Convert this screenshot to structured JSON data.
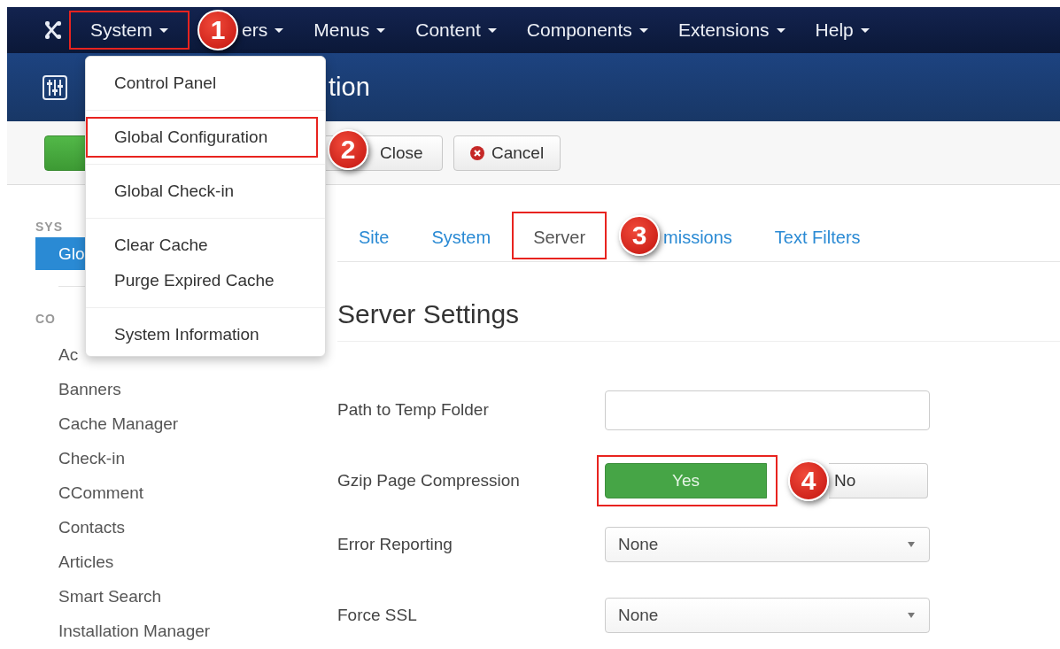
{
  "navbar": {
    "items": [
      {
        "label": "System",
        "highlighted": true,
        "badge": "1"
      },
      {
        "label": "ers",
        "highlighted": false
      },
      {
        "label": "Menus",
        "highlighted": false
      },
      {
        "label": "Content",
        "highlighted": false
      },
      {
        "label": "Components",
        "highlighted": false
      },
      {
        "label": "Extensions",
        "highlighted": false
      },
      {
        "label": "Help",
        "highlighted": false
      }
    ]
  },
  "dropdown": {
    "groups": [
      {
        "items": [
          {
            "label": "Control Panel",
            "highlighted": false
          }
        ]
      },
      {
        "items": [
          {
            "label": "Global Configuration",
            "highlighted": true,
            "badge": "2"
          }
        ]
      },
      {
        "items": [
          {
            "label": "Global Check-in",
            "highlighted": false
          }
        ]
      },
      {
        "items": [
          {
            "label": "Clear Cache",
            "highlighted": false
          },
          {
            "label": "Purge Expired Cache",
            "highlighted": false
          }
        ]
      },
      {
        "items": [
          {
            "label": "System Information",
            "highlighted": false
          }
        ]
      }
    ]
  },
  "header": {
    "title": "tion"
  },
  "toolbar": {
    "buttons": [
      {
        "kind": "save"
      },
      {
        "kind": "close",
        "label": "Close"
      },
      {
        "kind": "cancel",
        "label": "Cancel"
      }
    ]
  },
  "sidebar": {
    "sections": [
      {
        "heading": "SYS",
        "items": [
          {
            "label": "Glo",
            "selected": true
          }
        ]
      },
      {
        "heading": "CO",
        "items": [
          {
            "label": "Ac",
            "selected": false
          },
          {
            "label": "Banners",
            "selected": false
          },
          {
            "label": "Cache Manager",
            "selected": false
          },
          {
            "label": "Check-in",
            "selected": false
          },
          {
            "label": "CComment",
            "selected": false
          },
          {
            "label": "Contacts",
            "selected": false
          },
          {
            "label": "Articles",
            "selected": false
          },
          {
            "label": "Smart Search",
            "selected": false
          },
          {
            "label": "Installation Manager",
            "selected": false
          }
        ]
      }
    ]
  },
  "tabs": [
    {
      "label": "Site",
      "selected": false,
      "highlighted": false
    },
    {
      "label": "System",
      "selected": false,
      "highlighted": false
    },
    {
      "label": "Server",
      "selected": true,
      "highlighted": true,
      "badge": "3"
    },
    {
      "label": "missions",
      "selected": false,
      "highlighted": false
    },
    {
      "label": "Text Filters",
      "selected": false,
      "highlighted": false
    }
  ],
  "section_title": "Server Settings",
  "fields": [
    {
      "kind": "text",
      "label": "Path to Temp Folder"
    },
    {
      "kind": "toggle",
      "label": "Gzip Page Compression",
      "options": [
        {
          "label": "Yes",
          "selected": true,
          "highlighted": true,
          "badge": "4"
        },
        {
          "label": "No",
          "selected": false,
          "highlighted": false
        }
      ]
    },
    {
      "kind": "select",
      "label": "Error Reporting",
      "value": "None"
    },
    {
      "kind": "select",
      "label": "Force SSL",
      "value": "None"
    }
  ]
}
